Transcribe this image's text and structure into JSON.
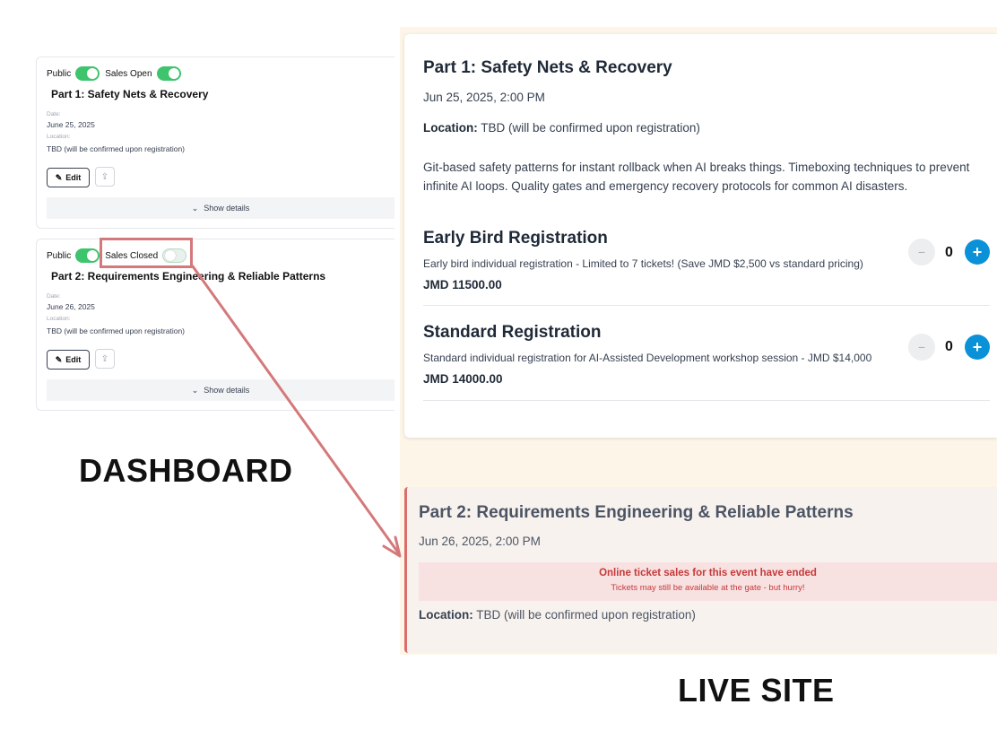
{
  "dashboard": {
    "label": "DASHBOARD",
    "events": [
      {
        "public_label": "Public",
        "sales_label": "Sales Open",
        "public_on": true,
        "sales_on": true,
        "title": "Part 1: Safety Nets & Recovery",
        "date_label": "Date:",
        "date": "June 25, 2025",
        "location_label": "Location:",
        "location": "TBD (will be confirmed upon registration)",
        "edit_label": "Edit",
        "show_details": "Show details"
      },
      {
        "public_label": "Public",
        "sales_label": "Sales Closed",
        "public_on": true,
        "sales_on": false,
        "title": "Part 2: Requirements Engineering & Reliable Patterns",
        "date_label": "Date:",
        "date": "June 26, 2025",
        "location_label": "Location:",
        "location": "TBD (will be confirmed upon registration)",
        "edit_label": "Edit",
        "show_details": "Show details"
      }
    ]
  },
  "live_site": {
    "label": "LIVE SITE",
    "event1": {
      "title": "Part 1: Safety Nets & Recovery",
      "date": "Jun 25, 2025, 2:00 PM",
      "location_label": "Location:",
      "location": "TBD (will be confirmed upon registration)",
      "description": "Git-based safety patterns for instant rollback when AI breaks things. Timeboxing techniques to prevent infinite AI loops. Quality gates and emergency recovery protocols for common AI disasters.",
      "tiers": [
        {
          "name": "Early Bird Registration",
          "description": "Early bird individual registration - Limited to 7 tickets! (Save JMD $2,500 vs standard pricing)",
          "price": "JMD 11500.00",
          "quantity": "0"
        },
        {
          "name": "Standard Registration",
          "description": "Standard individual registration for AI-Assisted Development workshop session - JMD $14,000",
          "price": "JMD 14000.00",
          "quantity": "0"
        }
      ]
    },
    "event2": {
      "title": "Part 2: Requirements Engineering & Reliable Patterns",
      "date": "Jun 26, 2025, 2:00 PM",
      "ended_title": "Online ticket sales for this event have ended",
      "ended_subtitle": "Tickets may still be available at the gate - but hurry!",
      "location_label": "Location:",
      "location": "TBD (will be confirmed upon registration)"
    }
  },
  "colors": {
    "toggle_on": "#3ec46d",
    "accent_blue": "#0a91d8",
    "closed_red": "#c53a3a",
    "highlight": "#d4797b"
  },
  "icons": [
    "pencil-icon",
    "share-icon",
    "chevron-down-icon",
    "minus-icon",
    "plus-icon"
  ]
}
